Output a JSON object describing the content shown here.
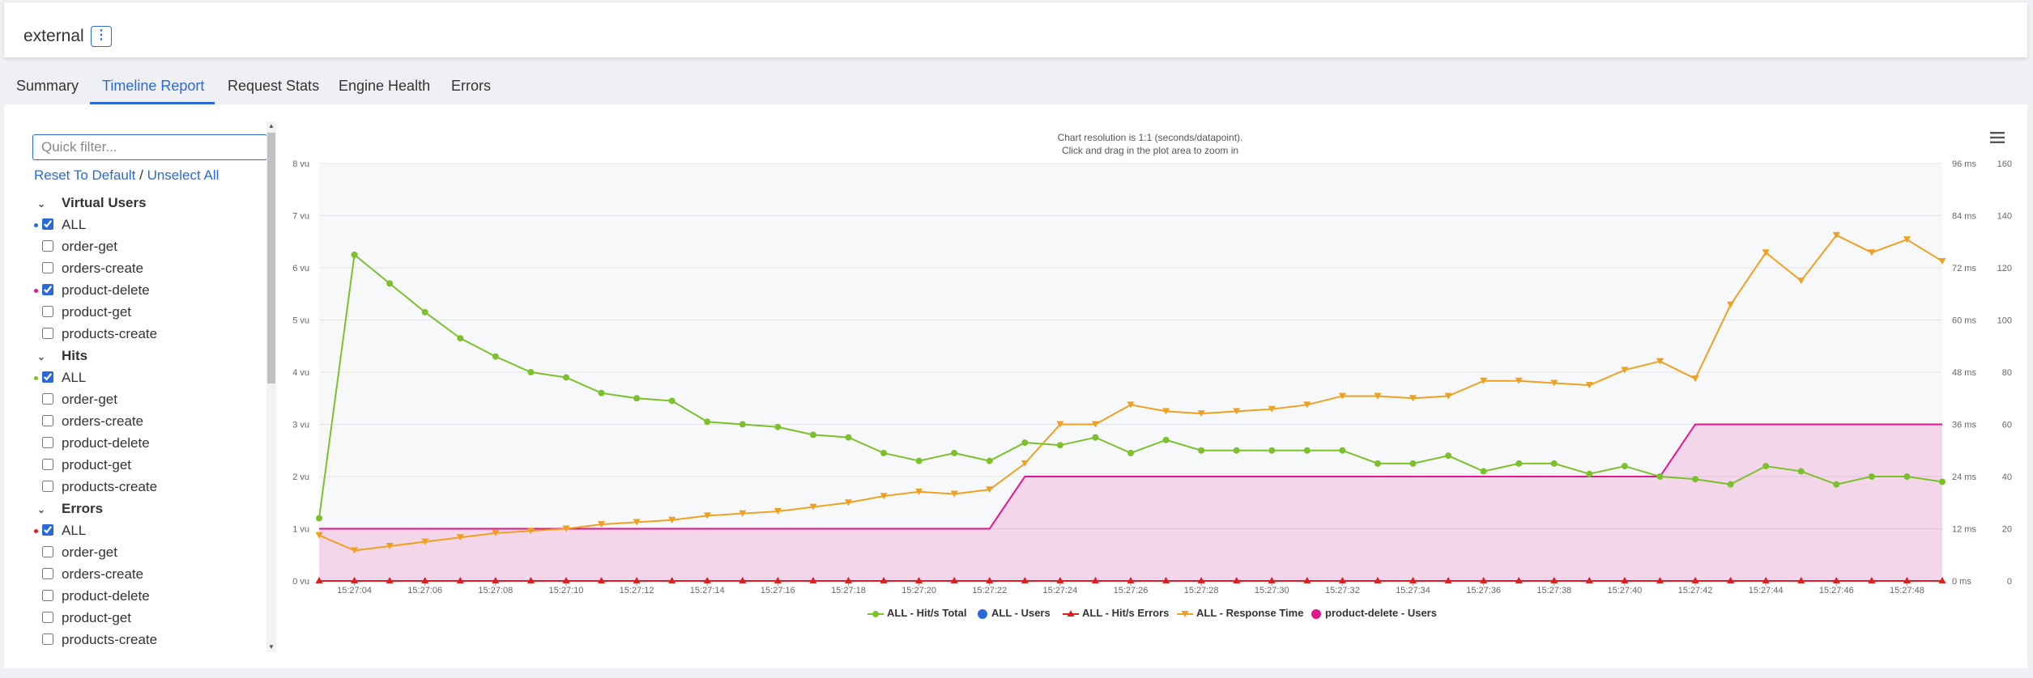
{
  "app": {
    "title": "external"
  },
  "tabs": [
    "Summary",
    "Timeline Report",
    "Request Stats",
    "Engine Health",
    "Errors"
  ],
  "sidebar": {
    "filter_placeholder": "Quick filter...",
    "reset_label": "Reset To Default",
    "separator": "/",
    "unselect_label": "Unselect All",
    "groups": [
      {
        "name": "Virtual Users",
        "items": [
          {
            "label": "ALL",
            "checked": true,
            "dot": "#2a6ad8"
          },
          {
            "label": "order-get",
            "checked": false
          },
          {
            "label": "orders-create",
            "checked": false
          },
          {
            "label": "product-delete",
            "checked": true,
            "dot": "#e0168a"
          },
          {
            "label": "product-get",
            "checked": false
          },
          {
            "label": "products-create",
            "checked": false
          }
        ]
      },
      {
        "name": "Hits",
        "items": [
          {
            "label": "ALL",
            "checked": true,
            "dot": "#7cc12b"
          },
          {
            "label": "order-get",
            "checked": false
          },
          {
            "label": "orders-create",
            "checked": false
          },
          {
            "label": "product-delete",
            "checked": false
          },
          {
            "label": "product-get",
            "checked": false
          },
          {
            "label": "products-create",
            "checked": false
          }
        ]
      },
      {
        "name": "Errors",
        "items": [
          {
            "label": "ALL",
            "checked": true,
            "dot": "#e01e1e"
          },
          {
            "label": "order-get",
            "checked": false
          },
          {
            "label": "orders-create",
            "checked": false
          },
          {
            "label": "product-delete",
            "checked": false
          },
          {
            "label": "product-get",
            "checked": false
          },
          {
            "label": "products-create",
            "checked": false
          }
        ]
      }
    ]
  },
  "chart_note": {
    "line1": "Chart resolution is 1:1 (seconds/datapoint).",
    "line2": "Click and drag in the plot area to zoom in"
  },
  "chart_data": {
    "type": "line",
    "x": [
      "15:27:03",
      "15:27:04",
      "15:27:05",
      "15:27:06",
      "15:27:07",
      "15:27:08",
      "15:27:09",
      "15:27:10",
      "15:27:11",
      "15:27:12",
      "15:27:13",
      "15:27:14",
      "15:27:15",
      "15:27:16",
      "15:27:17",
      "15:27:18",
      "15:27:19",
      "15:27:20",
      "15:27:21",
      "15:27:22",
      "15:27:23",
      "15:27:24",
      "15:27:25",
      "15:27:26",
      "15:27:27",
      "15:27:28",
      "15:27:29",
      "15:27:30",
      "15:27:31",
      "15:27:32",
      "15:27:33",
      "15:27:34",
      "15:27:35",
      "15:27:36",
      "15:27:37",
      "15:27:38",
      "15:27:39",
      "15:27:40",
      "15:27:41",
      "15:27:42",
      "15:27:43",
      "15:27:44",
      "15:27:45",
      "15:27:46",
      "15:27:47",
      "15:27:48",
      "15:27:49"
    ],
    "x_tick_labels": [
      "15:27:04",
      "15:27:06",
      "15:27:08",
      "15:27:10",
      "15:27:12",
      "15:27:14",
      "15:27:16",
      "15:27:18",
      "15:27:20",
      "15:27:22",
      "15:27:24",
      "15:27:26",
      "15:27:28",
      "15:27:30",
      "15:27:32",
      "15:27:34",
      "15:27:36",
      "15:27:38",
      "15:27:40",
      "15:27:42",
      "15:27:44",
      "15:27:46",
      "15:27:48"
    ],
    "y_left": {
      "unit": "vu",
      "ticks": [
        "0 vu",
        "1 vu",
        "2 vu",
        "3 vu",
        "4 vu",
        "5 vu",
        "6 vu",
        "7 vu",
        "8 vu"
      ],
      "range": [
        0,
        8
      ]
    },
    "y_right_ms": {
      "ticks": [
        "0 ms",
        "12 ms",
        "24 ms",
        "36 ms",
        "48 ms",
        "60 ms",
        "72 ms",
        "84 ms",
        "96 ms"
      ],
      "range": [
        0,
        96
      ]
    },
    "y_right_hits": {
      "ticks": [
        "0",
        "20",
        "40",
        "60",
        "80",
        "100",
        "120",
        "140",
        "160"
      ],
      "range": [
        0,
        160
      ]
    },
    "grid": true,
    "legend_position": "bottom-center",
    "series": [
      {
        "name": "ALL - Hit/s Total",
        "axis": "hits",
        "color": "#7cc12b",
        "marker": "circle",
        "values": [
          24,
          125,
          114,
          103,
          93,
          86,
          80,
          78,
          72,
          70,
          69,
          61,
          60,
          59,
          56,
          55,
          49,
          46,
          49,
          46,
          53,
          52,
          55,
          49,
          54,
          50,
          50,
          50,
          50,
          50,
          45,
          45,
          48,
          42,
          45,
          45,
          41,
          44,
          40,
          39,
          37,
          44,
          42,
          37,
          40,
          40,
          38
        ]
      },
      {
        "name": "ALL - Users",
        "axis": "vu",
        "color": "#2a6ad8",
        "marker": "circle",
        "values": []
      },
      {
        "name": "ALL - Hit/s Errors",
        "axis": "hits",
        "color": "#e01e1e",
        "marker": "triangle",
        "values": [
          0,
          0,
          0,
          0,
          0,
          0,
          0,
          0,
          0,
          0,
          0,
          0,
          0,
          0,
          0,
          0,
          0,
          0,
          0,
          0,
          0,
          0,
          0,
          0,
          0,
          0,
          0,
          0,
          0,
          0,
          0,
          0,
          0,
          0,
          0,
          0,
          0,
          0,
          0,
          0,
          0,
          0,
          0,
          0,
          0,
          0,
          0
        ]
      },
      {
        "name": "ALL - Response Time",
        "axis": "ms",
        "color": "#f0a020",
        "marker": "triangle-down",
        "values": [
          10.5,
          7,
          8,
          9,
          10,
          11,
          11.5,
          12,
          13,
          13.5,
          14,
          15,
          15.5,
          16,
          17,
          18,
          19.5,
          20.5,
          20,
          21,
          27,
          36,
          36,
          40.5,
          39,
          38.5,
          39,
          39.5,
          40.5,
          42.5,
          42.5,
          42,
          42.5,
          46,
          46,
          45.5,
          45,
          48.5,
          50.5,
          46.5,
          63.5,
          75.5,
          69,
          79.5,
          75.5,
          78.5,
          73.5
        ]
      },
      {
        "name": "product-delete - Users",
        "axis": "vu",
        "color": "#e0168a",
        "marker": "circle",
        "type": "area",
        "steps": [
          {
            "from": "15:27:03",
            "to": "15:27:22",
            "value": 1
          },
          {
            "from": "15:27:23",
            "to": "15:27:41",
            "value": 2
          },
          {
            "from": "15:27:42",
            "to": "15:27:49",
            "value": 3
          }
        ]
      }
    ]
  }
}
